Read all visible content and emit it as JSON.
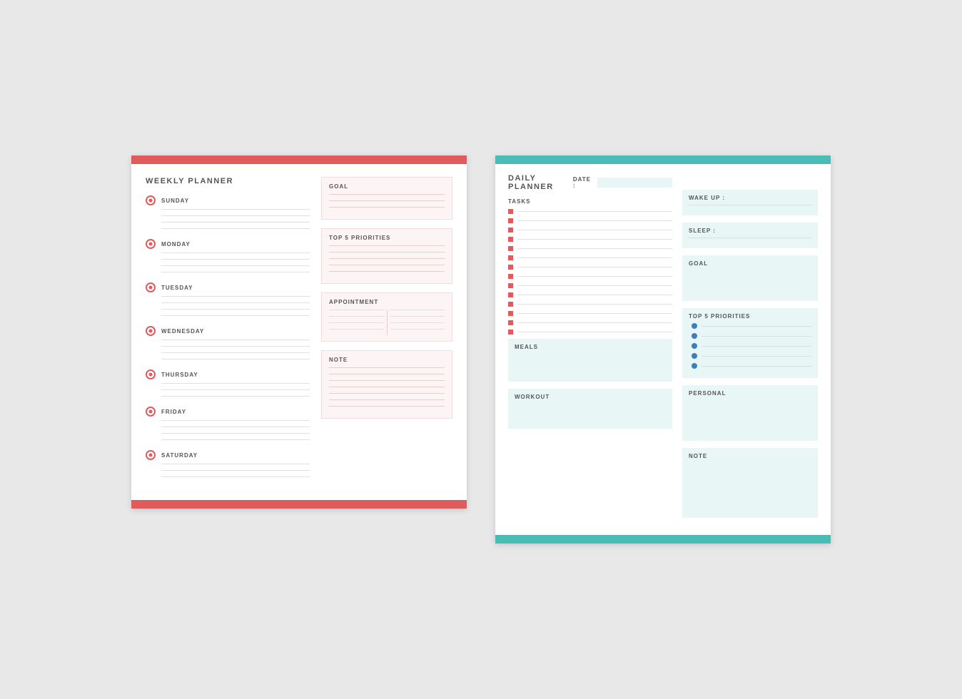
{
  "weekly": {
    "title": "WEEKLY PLANNER",
    "days": [
      {
        "label": "SUNDAY",
        "lines": 4
      },
      {
        "label": "MONDAY",
        "lines": 4
      },
      {
        "label": "TUESDAY",
        "lines": 4
      },
      {
        "label": "WEDNESDAY",
        "lines": 4
      },
      {
        "label": "THURSDAY",
        "lines": 3
      },
      {
        "label": "FRIDAY",
        "lines": 4
      },
      {
        "label": "SATURDAY",
        "lines": 3
      }
    ],
    "goal_label": "GOAL",
    "priorities_label": "TOP 5 PRIORITIES",
    "appointment_label": "APPOINTMENT",
    "note_label": "NOTE"
  },
  "daily": {
    "title": "DAILY PLANNER",
    "date_label": "DATE :",
    "tasks_label": "TASKS",
    "task_count": 14,
    "wake_up_label": "WAKE UP :",
    "sleep_label": "SLEEP :",
    "goal_label": "GOAL",
    "priorities_label": "TOP 5 PRIORITIES",
    "priority_count": 5,
    "personal_label": "PERSONAL",
    "note_label": "NOTE",
    "meals_label": "MEALS",
    "workout_label": "WORKOUT"
  }
}
